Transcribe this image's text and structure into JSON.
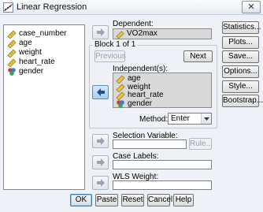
{
  "window": {
    "title": "Linear Regression",
    "close_symbol": "✕"
  },
  "variables": [
    {
      "label": "case_number",
      "icon": "scale-ruler-icon"
    },
    {
      "label": "age",
      "icon": "scale-ruler-icon"
    },
    {
      "label": "weight",
      "icon": "scale-ruler-icon"
    },
    {
      "label": "heart_rate",
      "icon": "scale-ruler-icon"
    },
    {
      "label": "gender",
      "icon": "nominal-circles-icon"
    }
  ],
  "dependent": {
    "label": "Dependent:",
    "value": "VO2max"
  },
  "block": {
    "title": "Block 1 of 1",
    "previous_label": "Previous",
    "next_label": "Next",
    "independent_label": "Independent(s):",
    "independents": [
      "age",
      "weight",
      "heart_rate",
      "gender"
    ],
    "method_label": "Method:",
    "method_value": "Enter"
  },
  "selection": {
    "label": "Selection Variable:",
    "rule_label": "Rule..."
  },
  "case_labels": {
    "label": "Case Labels:"
  },
  "wls": {
    "label": "WLS Weight:"
  },
  "side_buttons": [
    "Statistics...",
    "Plots...",
    "Save...",
    "Options...",
    "Style...",
    "Bootstrap..."
  ],
  "bottom_buttons": [
    "OK",
    "Paste",
    "Reset",
    "Cancel",
    "Help"
  ],
  "colors": {
    "accent": "#3c7fb1",
    "selected_field": "#d9d9d9"
  }
}
